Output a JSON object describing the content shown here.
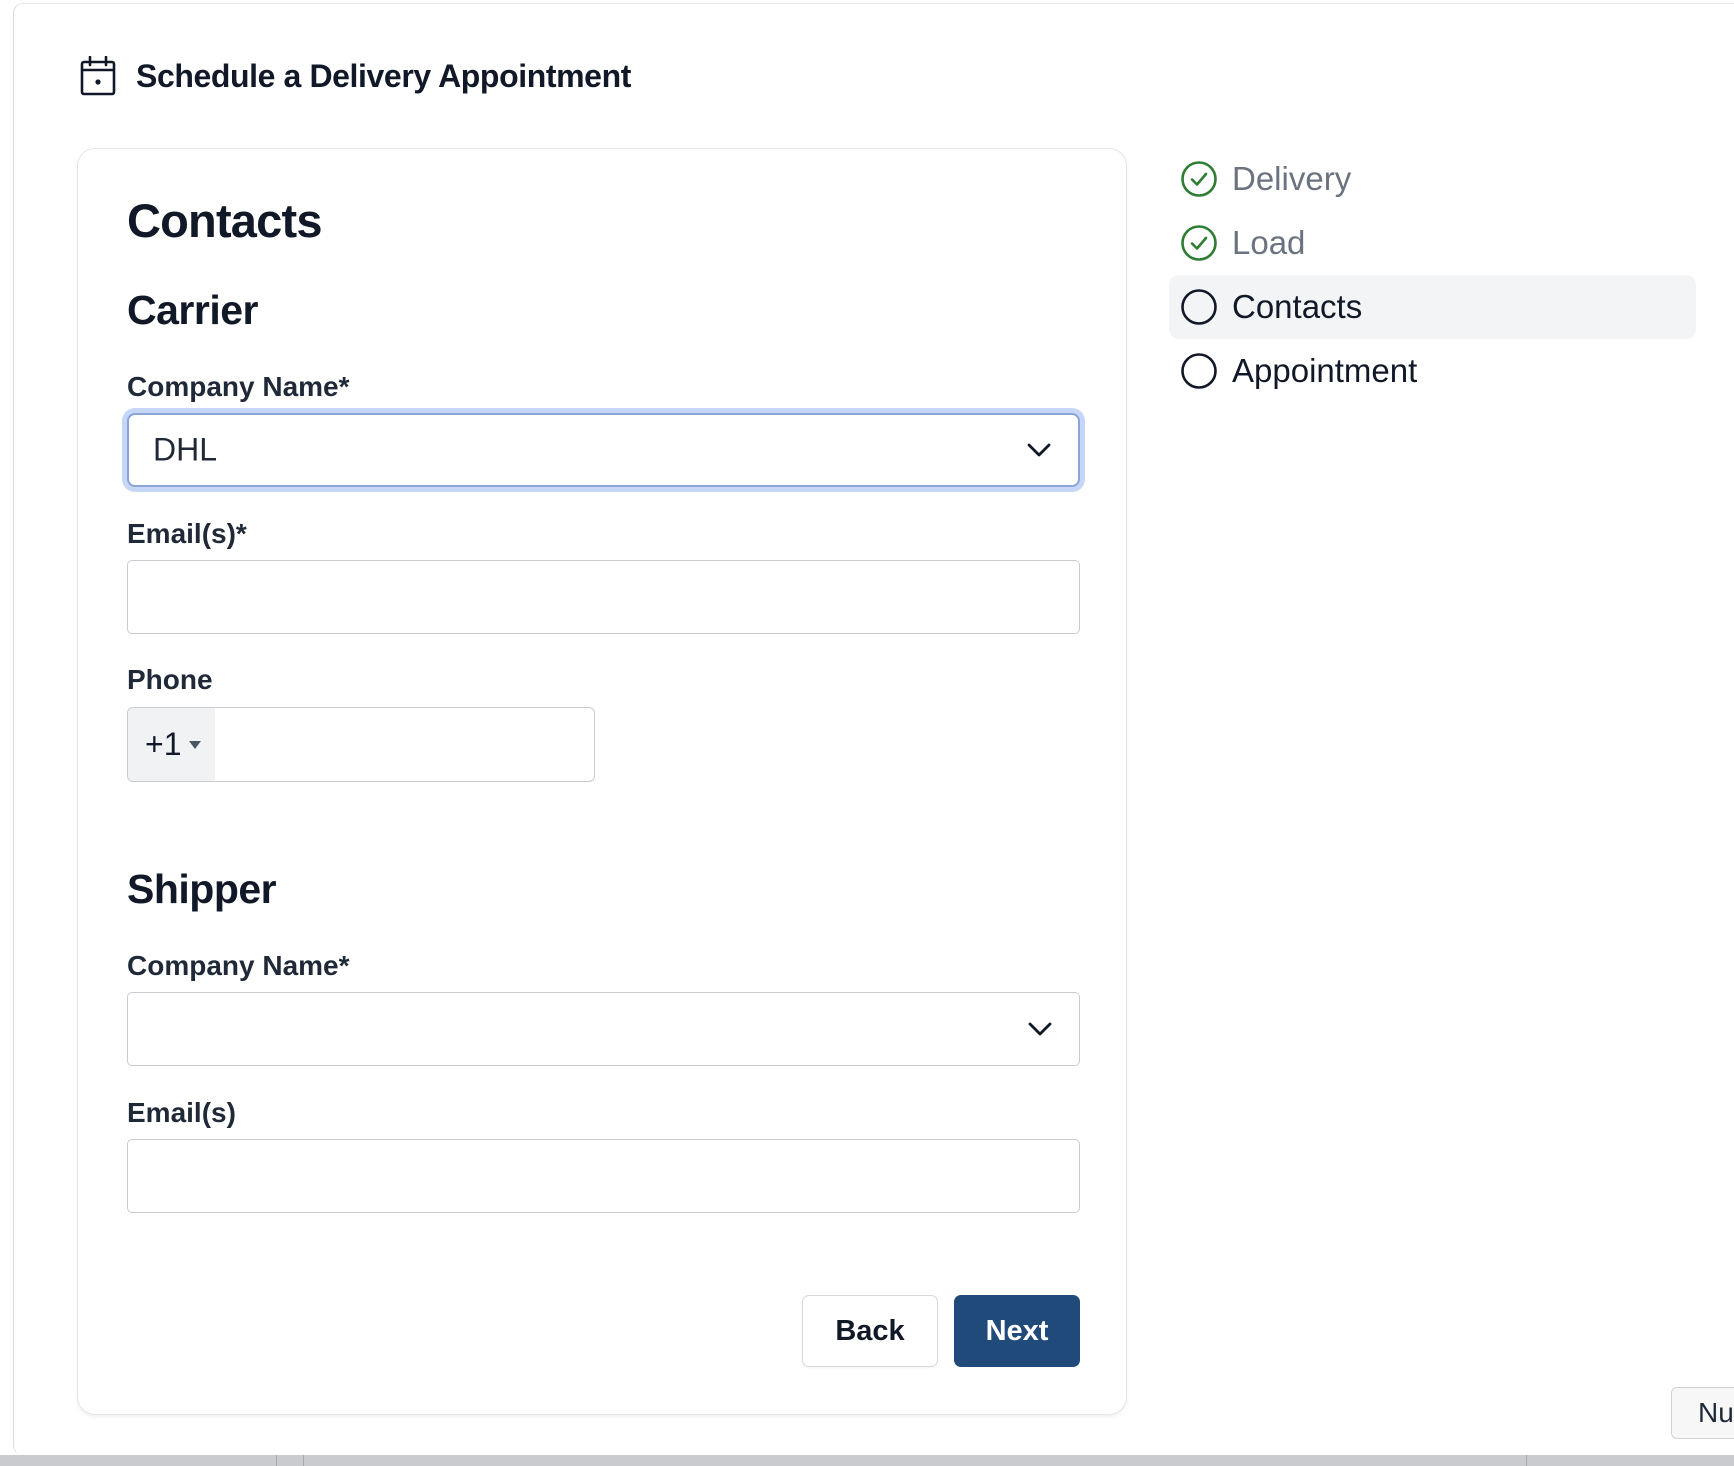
{
  "header": {
    "title": "Schedule a Delivery Appointment",
    "icon": "calendar-icon"
  },
  "form": {
    "section_title": "Contacts",
    "carrier": {
      "heading": "Carrier",
      "company_label": "Company Name*",
      "company_value": "DHL",
      "email_label": "Email(s)*",
      "email_value": "",
      "phone_label": "Phone",
      "phone_country_code": "+1",
      "phone_value": ""
    },
    "shipper": {
      "heading": "Shipper",
      "company_label": "Company Name*",
      "company_value": "",
      "email_label": "Email(s)",
      "email_value": ""
    },
    "buttons": {
      "back_label": "Back",
      "next_label": "Next"
    }
  },
  "stepper": {
    "steps": [
      {
        "label": "Delivery",
        "status": "complete"
      },
      {
        "label": "Load",
        "status": "complete"
      },
      {
        "label": "Contacts",
        "status": "current"
      },
      {
        "label": "Appointment",
        "status": "pending"
      }
    ]
  },
  "floating_tab": {
    "label": "Nu"
  },
  "colors": {
    "primary_button": "#1f4a7a",
    "complete_check": "#2e7d32",
    "focus_ring": "#c5d6f6",
    "active_step_bg": "#f3f4f6"
  }
}
